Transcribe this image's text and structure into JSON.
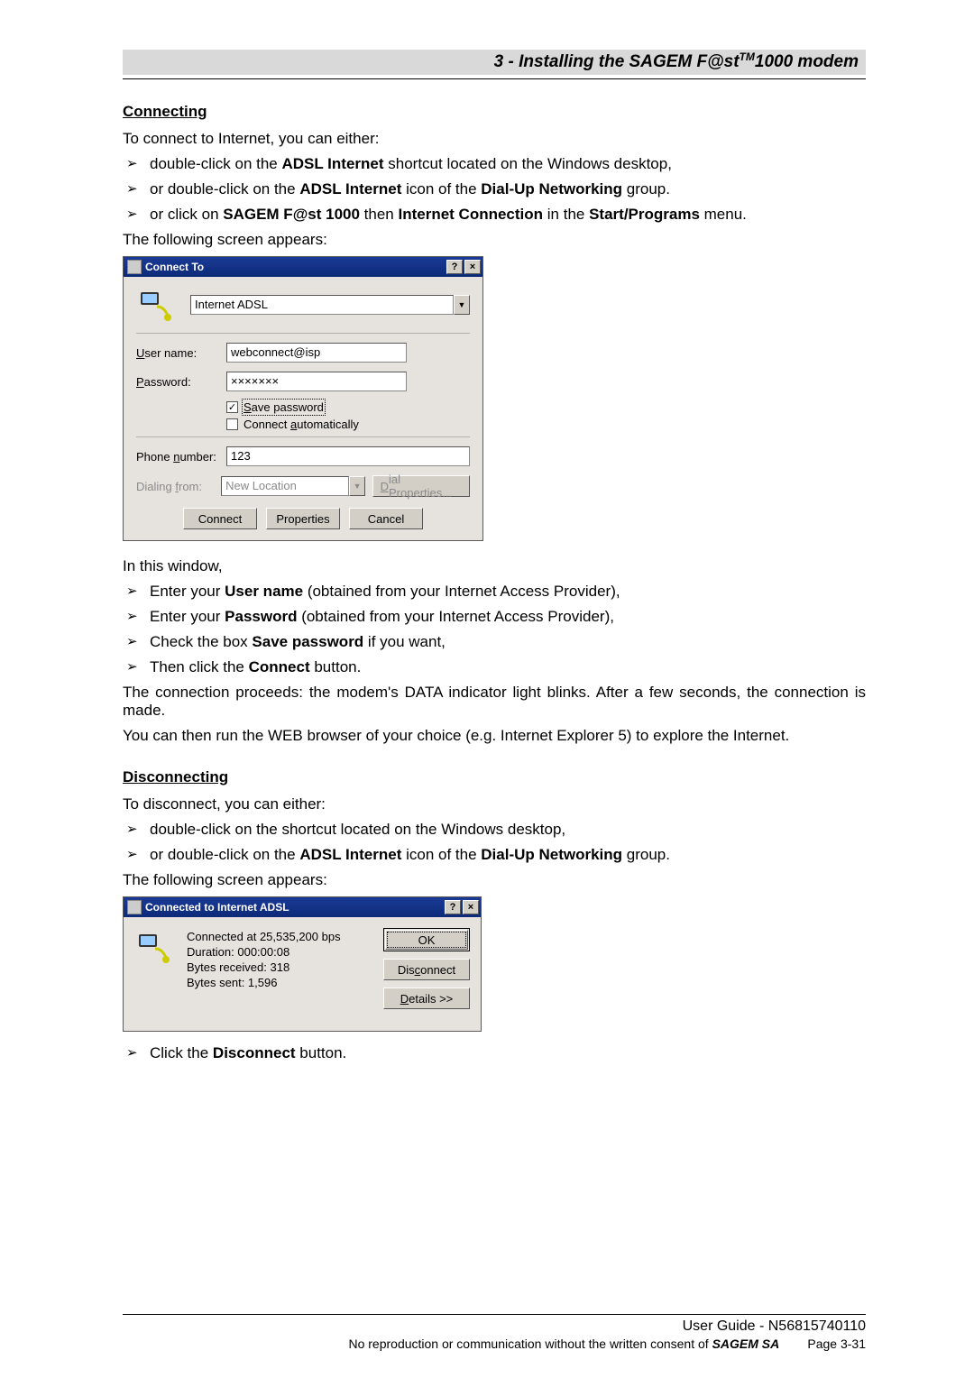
{
  "header": {
    "title_prefix": "3 - Installing the SAGEM F@st",
    "title_sup": "TM",
    "title_suffix": " 1000 modem"
  },
  "s1_title": "Connecting",
  "s1_intro": "To connect to Internet, you can either:",
  "s1_b1_a": "double-click on the ",
  "s1_b1_b": "ADSL Internet",
  "s1_b1_c": " shortcut located on the Windows desktop,",
  "s1_b2_a": "or double-click on the ",
  "s1_b2_b": "ADSL Internet",
  "s1_b2_c": " icon of the ",
  "s1_b2_d": "Dial-Up Networking",
  "s1_b2_e": " group.",
  "s1_b3_a": "or click on ",
  "s1_b3_b": "SAGEM F@st 1000",
  "s1_b3_c": " then ",
  "s1_b3_d": "Internet Connection",
  "s1_b3_e": " in the ",
  "s1_b3_f": "Start/Programs",
  "s1_b3_g": " menu.",
  "s1_after": "The following screen appears:",
  "dlg1": {
    "title": "Connect To",
    "help": "?",
    "close": "×",
    "combo_value": "Internet ADSL",
    "user_label_u": "U",
    "user_label_rest": "ser name:",
    "user_value": "webconnect@isp",
    "pass_label_p": "P",
    "pass_label_rest": "assword:",
    "pass_value": "×××××××",
    "chk1_s": "S",
    "chk1_rest": "ave password",
    "chk2_rest1": "Connect ",
    "chk2_a": "a",
    "chk2_rest2": "utomatically",
    "phone_label_rest1": "Phone ",
    "phone_label_n": "n",
    "phone_label_rest2": "umber:",
    "phone_value": "123",
    "dialfrom_rest1": "Dialing ",
    "dialfrom_f": "f",
    "dialfrom_rest2": "rom:",
    "dialfrom_value": "New Location",
    "dialprops_d": "D",
    "dialprops_rest": "ial Properties...",
    "btn_connect": "Connect",
    "btn_properties": "Properties",
    "btn_cancel": "Cancel"
  },
  "s2_intro": "In this window,",
  "s2_b1_a": "Enter your ",
  "s2_b1_b": "User name",
  "s2_b1_c": " (obtained from your Internet Access Provider),",
  "s2_b2_a": "Enter your ",
  "s2_b2_b": "Password",
  "s2_b2_c": " (obtained from your Internet Access Provider),",
  "s2_b3_a": "Check the box ",
  "s2_b3_b": "Save password",
  "s2_b3_c": " if you want,",
  "s2_b4_a": "Then click the ",
  "s2_b4_b": "Connect",
  "s2_b4_c": " button.",
  "s2_para": "The connection proceeds: the modem's DATA indicator light blinks. After a few seconds, the connection is made.",
  "s2_para2": "You can then run the WEB browser of your choice (e.g. Internet Explorer 5) to explore the Internet.",
  "s3_title": "Disconnecting",
  "s3_intro": "To disconnect, you can either:",
  "s3_b1": "double-click on the shortcut located on the Windows desktop,",
  "s3_b2_a": "or double-click on the ",
  "s3_b2_b": "ADSL Internet",
  "s3_b2_c": " icon of the ",
  "s3_b2_d": "Dial-Up Networking",
  "s3_b2_e": " group.",
  "s3_after": "The following screen appears:",
  "dlg2": {
    "title": "Connected to Internet ADSL",
    "help": "?",
    "close": "×",
    "line1": "Connected at 25,535,200 bps",
    "line2": "Duration: 000:00:08",
    "line3": "Bytes received: 318",
    "line4": "Bytes sent: 1,596",
    "btn_ok": "OK",
    "btn_disc_rest1": "Dis",
    "btn_disc_c": "c",
    "btn_disc_rest2": "onnect",
    "btn_det_d": "D",
    "btn_det_rest": "etails >>"
  },
  "s4_b1_a": "Click the ",
  "s4_b1_b": "Disconnect",
  "s4_b1_c": " button.",
  "footer": {
    "r1": "User Guide - N56815740110",
    "r2a": "No reproduction or communication without the written consent of ",
    "r2b": "SAGEM SA",
    "r2c": "        Page 3-31"
  }
}
